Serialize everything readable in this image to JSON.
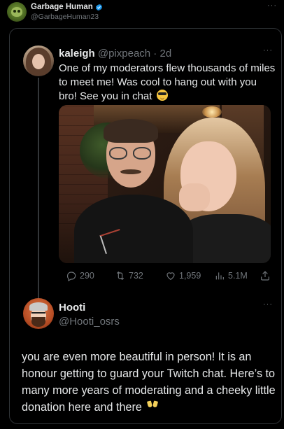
{
  "outer_tweet": {
    "author_name": "Garbage Human",
    "author_handle": "@GarbageHuman23",
    "more_label": "···"
  },
  "quoted_tweet": {
    "author_name": "kaleigh",
    "author_handle": "@pixpeach",
    "separator": " · ",
    "time_ago": "2d",
    "more_label": "···",
    "text": "One of my moderators flew thousands of miles to meet me! Was cool to hang out with you bro! See you in chat",
    "emoji": "smiling-face-with-sunglasses",
    "stats": {
      "replies": "290",
      "retweets": "732",
      "likes": "1,959",
      "views": "5.1M"
    }
  },
  "reply_tweet": {
    "author_name": "Hooti",
    "author_handle": "@Hooti_osrs",
    "more_label": "···",
    "text": "you are even more beautiful in person! It is an honour getting to guard your Twitch chat. Here’s to many more years of moderating and a cheeky little donation here and there",
    "emoji": "clinking-glasses"
  },
  "colors": {
    "background": "#000000",
    "text_primary": "#e7e9ea",
    "text_secondary": "#71767b",
    "verified_badge": "#1d9bf0",
    "border": "#2f3336"
  }
}
